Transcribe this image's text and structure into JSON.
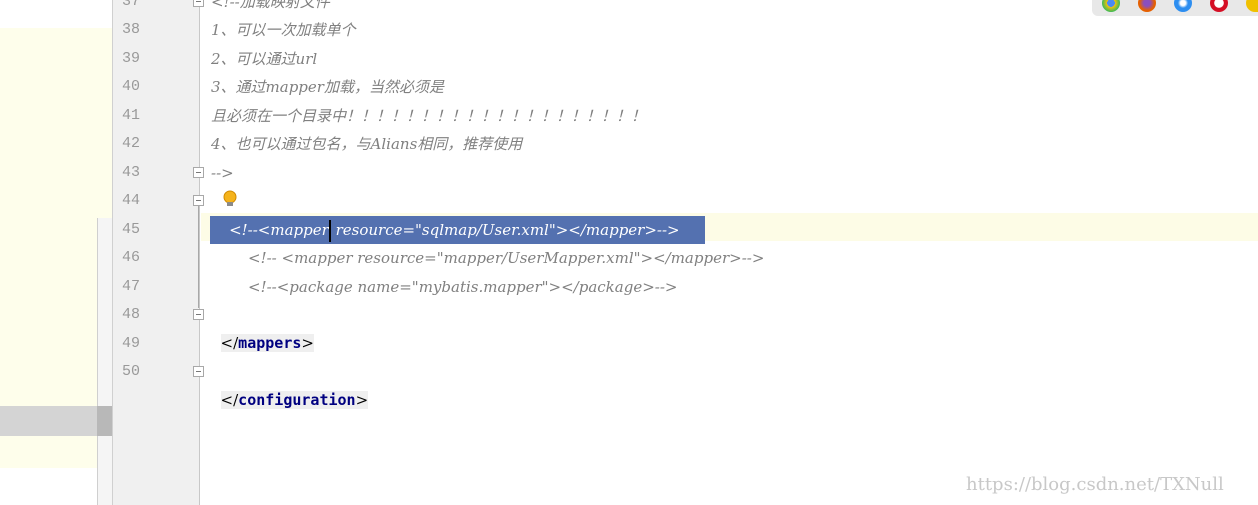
{
  "editor": {
    "lines": [
      {
        "num": "37",
        "text": "<!--加载映射文件"
      },
      {
        "num": "38",
        "text": "1、可以一次加载单个"
      },
      {
        "num": "39",
        "text": "2、可以通过url"
      },
      {
        "num": "40",
        "text": "3、通过mapper加载，当然必须是"
      },
      {
        "num": "41",
        "text": "且必须在一个目录中！！！！！！！！！！！！！！！！！！！！"
      },
      {
        "num": "42",
        "text": "4、也可以通过包名，与Alians相同，推荐使用"
      },
      {
        "num": "43",
        "text": "-->"
      },
      {
        "num": "44",
        "open": "<",
        "name": "mappers",
        "close": ">"
      },
      {
        "num": "45",
        "text": "<!--<mapper resource=\"sqlmap/User.xml\"></mapper>-->"
      },
      {
        "num": "46",
        "text": "<!-- <mapper resource=\"mapper/UserMapper.xml\"></mapper>-->"
      },
      {
        "num": "47",
        "text": "<!--<package name=\"mybatis.mapper\"></package>-->"
      },
      {
        "num": "48",
        "open": "</",
        "name": "mappers",
        "close": ">"
      },
      {
        "num": "49",
        "text": ""
      },
      {
        "num": "50",
        "open": "</",
        "name": "configuration",
        "close": ">"
      }
    ],
    "sel_part1": "<!--<mapper",
    "sel_part2": " resource=\"sqlmap/User.xml\"></mapper>-->"
  },
  "colors": {
    "selection": "#5471b0",
    "comment": "#808080",
    "tag": "#000080",
    "current_line": "#fdfce6"
  },
  "browser_icons": [
    "chrome-icon",
    "firefox-icon",
    "safari-icon",
    "opera-icon",
    "ie-icon"
  ],
  "watermark": "https://blog.csdn.net/TXNull"
}
